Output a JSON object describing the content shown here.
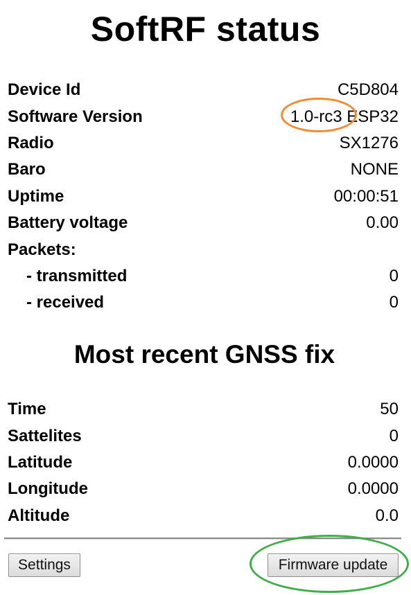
{
  "page": {
    "title": "SoftRF status"
  },
  "status": {
    "rows": [
      {
        "label": "Device Id",
        "value": "C5D804"
      },
      {
        "label": "Software Version",
        "version": "1.0-rc3",
        "platform": "ESP32"
      },
      {
        "label": "Radio",
        "value": "SX1276"
      },
      {
        "label": "Baro",
        "value": "NONE"
      },
      {
        "label": "Uptime",
        "value": "00:00:51"
      },
      {
        "label": "Battery voltage",
        "value": "0.00"
      },
      {
        "label": "Packets:",
        "value": ""
      },
      {
        "label": "- transmitted",
        "value": "0"
      },
      {
        "label": "- received",
        "value": "0"
      }
    ]
  },
  "gnss": {
    "title": "Most recent GNSS fix",
    "rows": [
      {
        "label": "Time",
        "value": "50"
      },
      {
        "label": "Sattelites",
        "value": "0"
      },
      {
        "label": "Latitude",
        "value": "0.0000"
      },
      {
        "label": "Longitude",
        "value": "0.0000"
      },
      {
        "label": "Altitude",
        "value": "0.0"
      }
    ]
  },
  "buttons": {
    "settings_label": "Settings",
    "firmware_label": "Firmware update"
  },
  "colors": {
    "version_highlight": "#f28a30",
    "firmware_highlight": "#3fae49"
  }
}
